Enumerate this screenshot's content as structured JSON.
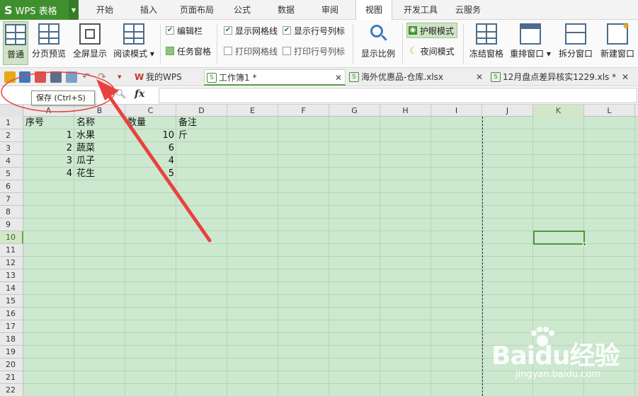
{
  "app": {
    "logo": "S",
    "name": "WPS 表格"
  },
  "menu": {
    "tabs": [
      "开始",
      "插入",
      "页面布局",
      "公式",
      "数据",
      "审阅",
      "视图",
      "开发工具",
      "云服务"
    ],
    "active": "视图"
  },
  "ribbon": {
    "normal": "普通",
    "page_break_preview": "分页预览",
    "fullscreen": "全屏显示",
    "reading_mode": "阅读模式",
    "edit_bar": "编辑栏",
    "task_pane": "任务窗格",
    "show_gridlines": "显示网格线",
    "print_gridlines": "打印网格线",
    "show_row_col_headers": "显示行号列标",
    "print_row_col_headers": "打印行号列标",
    "zoom": "显示比例",
    "eye_protection": "护眼模式",
    "night_mode": "夜间模式",
    "freeze_panes": "冻结窗格",
    "rearrange_windows": "重排窗口",
    "split_window": "拆分窗口",
    "new_window": "新建窗口"
  },
  "doc_tabs": [
    {
      "label": "我的WPS"
    },
    {
      "label": "工作簿1 *"
    },
    {
      "label": "海外优惠品-仓库.xlsx"
    },
    {
      "label": "12月盘点差异核实1229.xls *"
    }
  ],
  "formula_bar": {
    "fx": "fx",
    "value": ""
  },
  "tooltip": "保存 (Ctrl+S)",
  "sheet": {
    "columns": [
      "A",
      "B",
      "C",
      "D",
      "E",
      "F",
      "G",
      "H",
      "I",
      "J",
      "K",
      "L"
    ],
    "selected_column": "K",
    "selected_row": 10,
    "rows": [
      "1",
      "2",
      "3",
      "4",
      "5",
      "6",
      "7",
      "8",
      "9",
      "10",
      "11",
      "12",
      "13",
      "14",
      "15",
      "16",
      "17",
      "18",
      "19",
      "20",
      "21",
      "22"
    ],
    "cells": {
      "A1": "序号",
      "B1": "名称",
      "C1": "数量",
      "D1": "备注",
      "A2": "1",
      "B2": "水果",
      "C2": "10",
      "D2": "斤",
      "A3": "2",
      "B3": "蔬菜",
      "C3": "6",
      "A4": "3",
      "B4": "瓜子",
      "C4": "4",
      "A5": "4",
      "B5": "花生",
      "C5": "5"
    }
  },
  "watermark": {
    "brand": "Baidu经验",
    "url": "jingyan.baidu.com"
  },
  "colors": {
    "accent": "#3f8f2e",
    "sheet_bg": "#cce8cf",
    "annotation": "#e8423f"
  }
}
